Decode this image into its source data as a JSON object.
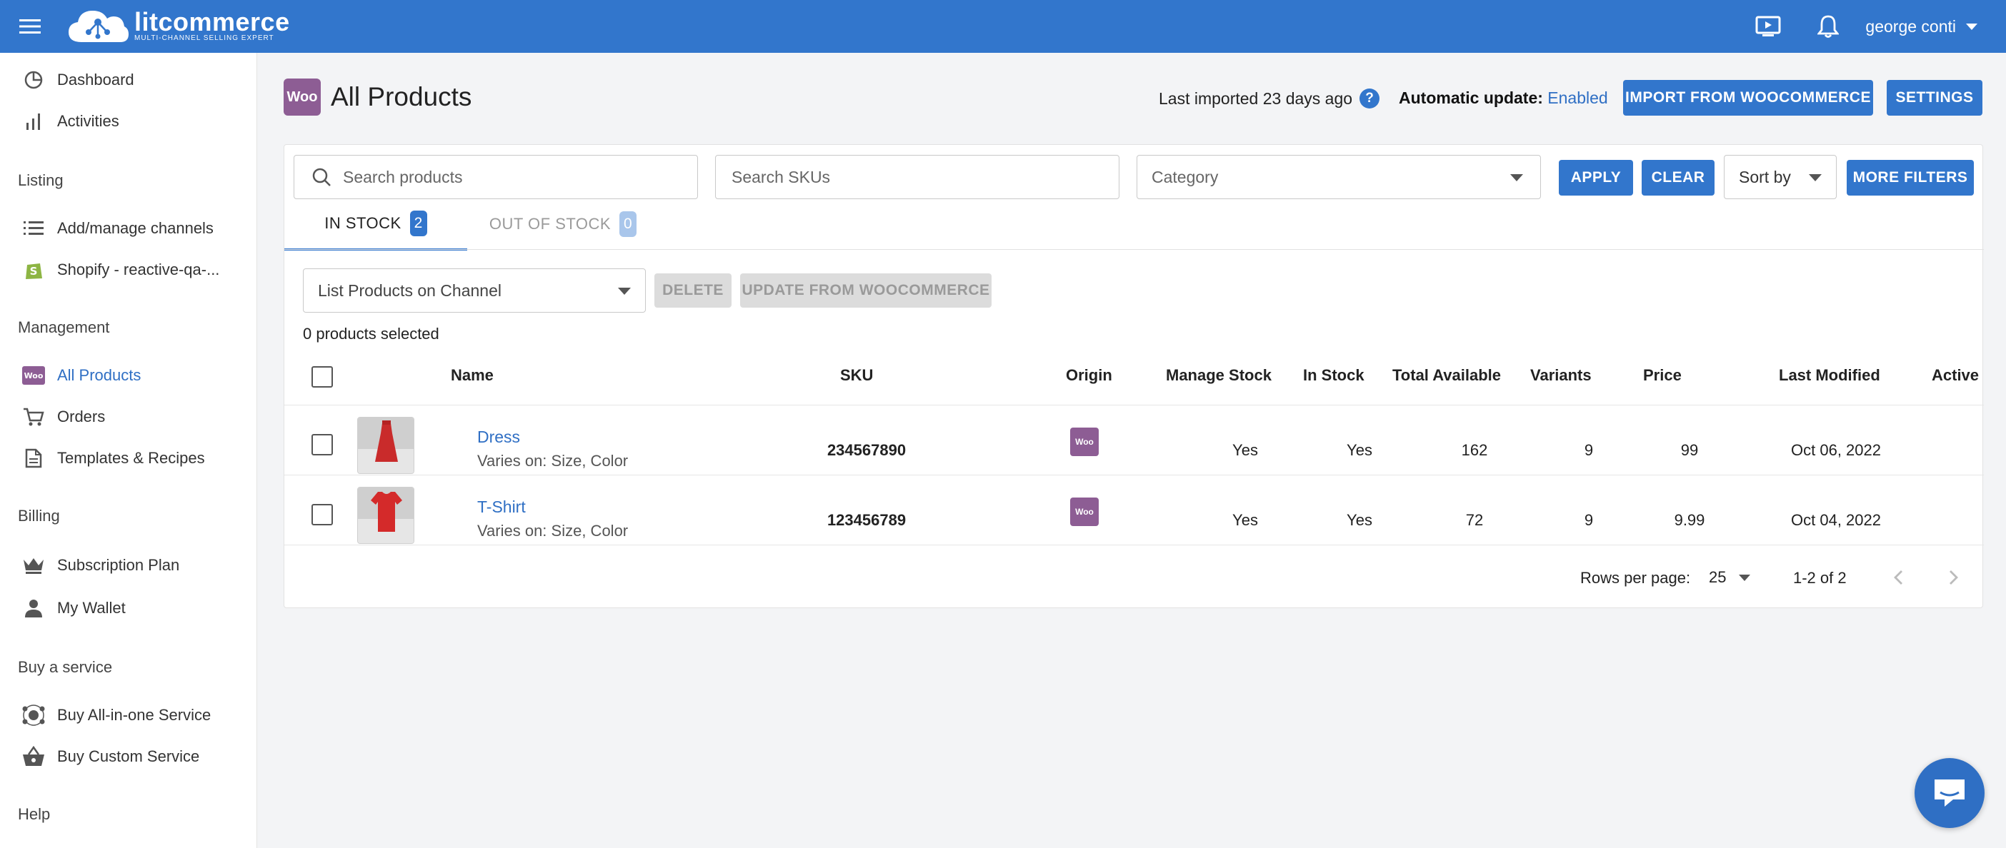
{
  "app": {
    "logo_name": "litcommerce",
    "logo_tag": "MULTI-CHANNEL SELLING EXPERT",
    "user_name": "george conti"
  },
  "sidebar": {
    "dashboard": "Dashboard",
    "activities": "Activities",
    "section_listing": "Listing",
    "add_channels": "Add/manage channels",
    "shopify_channel": "Shopify - reactive-qa-...",
    "section_management": "Management",
    "all_products": "All Products",
    "orders": "Orders",
    "templates": "Templates & Recipes",
    "section_billing": "Billing",
    "subscription": "Subscription Plan",
    "wallet": "My Wallet",
    "section_buy": "Buy a service",
    "buy_allinone": "Buy All-in-one Service",
    "buy_custom": "Buy Custom Service",
    "section_help": "Help"
  },
  "header": {
    "woo_badge": "Woo",
    "title": "All Products",
    "last_imported": "Last imported 23 days ago",
    "help": "?",
    "auto_update_label": "Automatic update:",
    "auto_update_value": "Enabled",
    "import_button": "IMPORT FROM WOOCOMMERCE",
    "settings_button": "SETTINGS"
  },
  "filters": {
    "search_products_placeholder": "Search products",
    "search_skus_placeholder": "Search SKUs",
    "category_placeholder": "Category",
    "apply": "APPLY",
    "clear": "CLEAR",
    "sort_by": "Sort by",
    "more_filters": "MORE FILTERS"
  },
  "tabs": {
    "in_stock": "IN STOCK",
    "in_stock_count": "2",
    "out_of_stock": "OUT OF STOCK",
    "out_of_stock_count": "0"
  },
  "actions": {
    "list_on_channel": "List Products on Channel",
    "delete": "DELETE",
    "update_from": "UPDATE FROM WOOCOMMERCE",
    "selected_count": "0 products selected"
  },
  "table": {
    "columns": {
      "name": "Name",
      "sku": "SKU",
      "origin": "Origin",
      "manage_stock": "Manage Stock",
      "in_stock": "In Stock",
      "total_available": "Total Available",
      "variants": "Variants",
      "price": "Price",
      "last_modified": "Last Modified",
      "active": "Active"
    },
    "rows": [
      {
        "name": "Dress",
        "varies": "Varies on: Size, Color",
        "sku": "234567890",
        "origin_badge": "Woo",
        "manage_stock": "Yes",
        "in_stock": "Yes",
        "total_available": "162",
        "variants": "9",
        "price": "99",
        "last_modified": "Oct 06, 2022"
      },
      {
        "name": "T-Shirt",
        "varies": "Varies on: Size, Color",
        "sku": "123456789",
        "origin_badge": "Woo",
        "manage_stock": "Yes",
        "in_stock": "Yes",
        "total_available": "72",
        "variants": "9",
        "price": "9.99",
        "last_modified": "Oct 04, 2022"
      }
    ]
  },
  "pagination": {
    "rows_per_page_label": "Rows per page:",
    "rows_per_page": "25",
    "range": "1-2 of 2"
  },
  "colors": {
    "primary": "#3276cc",
    "woo_purple": "#8d5d94",
    "link": "#2f6fc4"
  }
}
